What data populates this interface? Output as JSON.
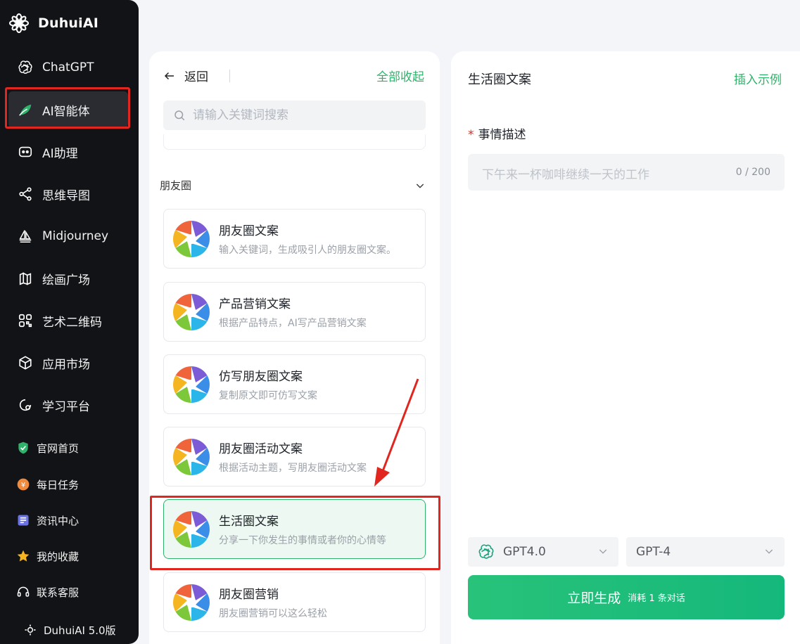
{
  "brand": {
    "name": "DuhuiAI"
  },
  "nav": [
    {
      "label": "ChatGPT",
      "icon": "openai-icon"
    },
    {
      "label": "AI智能体",
      "icon": "agent-leaf-icon",
      "active": true
    },
    {
      "label": "AI助理",
      "icon": "robot-icon"
    },
    {
      "label": "思维导图",
      "icon": "mindmap-icon"
    },
    {
      "label": "Midjourney",
      "icon": "sailboat-icon"
    },
    {
      "label": "绘画广场",
      "icon": "map-book-icon"
    },
    {
      "label": "艺术二维码",
      "icon": "qrcode-icon"
    },
    {
      "label": "应用市场",
      "icon": "cube-icon"
    },
    {
      "label": "学习平台",
      "icon": "learn-icon"
    }
  ],
  "links": [
    {
      "label": "官网首页",
      "icon": "shield-check-icon"
    },
    {
      "label": "每日任务",
      "icon": "coin-icon"
    },
    {
      "label": "资讯中心",
      "icon": "news-icon"
    },
    {
      "label": "我的收藏",
      "icon": "star-icon"
    },
    {
      "label": "联系客服",
      "icon": "headset-icon"
    },
    {
      "label": "DuhuiAI 5.0版",
      "icon": "version-icon"
    }
  ],
  "list": {
    "back_label": "返回",
    "collapse_all": "全部收起",
    "search_placeholder": "请输入关键词搜索",
    "category": "朋友圈",
    "cards": [
      {
        "title": "朋友圈文案",
        "desc": "输入关键词，生成吸引人的朋友圈文案。"
      },
      {
        "title": "产品营销文案",
        "desc": "根据产品特点，AI写产品营销文案"
      },
      {
        "title": "仿写朋友圈文案",
        "desc": "复制原文即可仿写文案"
      },
      {
        "title": "朋友圈活动文案",
        "desc": "根据活动主题，写朋友圈活动文案"
      },
      {
        "title": "生活圈文案",
        "desc": "分享一下你发生的事情或者你的心情等",
        "selected": true
      },
      {
        "title": "朋友圈营销",
        "desc": "朋友圈营销可以这么轻松"
      }
    ]
  },
  "form": {
    "title": "生活圈文案",
    "insert_example": "插入示例",
    "field_required_mark": "*",
    "field_label": "事情描述",
    "field_placeholder": "下午来一杯咖啡继续一天的工作",
    "field_count": "0 / 200",
    "model_select": "GPT4.0",
    "version_select": "GPT-4",
    "generate_label": "立即生成",
    "generate_cost": "消耗 1 条对话"
  },
  "colors": {
    "accent": "#2fb36a",
    "sidebar_bg": "#121316",
    "highlight_red": "#e0261e"
  }
}
